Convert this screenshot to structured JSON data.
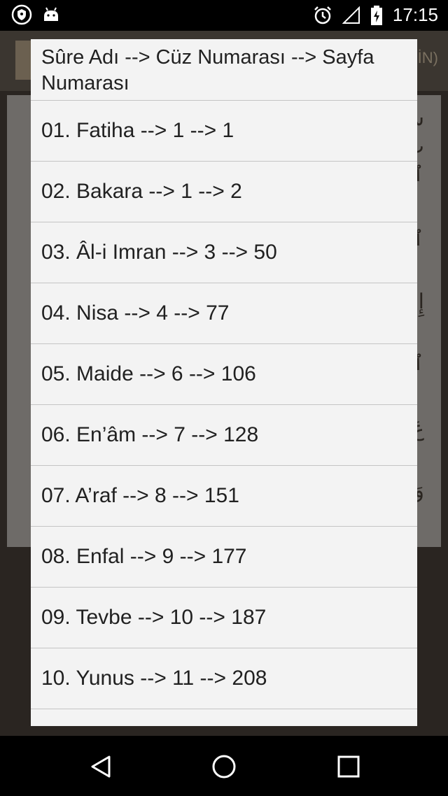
{
  "status_bar": {
    "time": "17:15"
  },
  "background": {
    "title_fragment": "İN)",
    "arabic_lines": [
      "س",
      "بِ",
      "ٱلْ",
      "ٱل",
      "إِيَّ",
      "ٱل",
      "عَ",
      "وَ"
    ]
  },
  "dialog": {
    "title": "Sûre Adı --> Cüz Numarası --> Sayfa Numarası",
    "items": [
      "01. Fatiha --> 1 --> 1",
      "02. Bakara --> 1 --> 2",
      "03. Âl-i Imran --> 3 --> 50",
      "04. Nisa --> 4 --> 77",
      "05. Maide --> 6 --> 106",
      "06. En’âm --> 7 --> 128",
      "07. A’raf --> 8 --> 151",
      "08. Enfal --> 9 --> 177",
      "09. Tevbe --> 10 --> 187",
      "10. Yunus --> 11 --> 208"
    ]
  },
  "icons": {
    "shield": "shield-icon",
    "android": "android-icon",
    "alarm": "alarm-icon",
    "signal": "signal-icon",
    "battery": "battery-charging-icon",
    "back": "back-icon",
    "home": "home-icon",
    "recents": "recents-icon"
  }
}
